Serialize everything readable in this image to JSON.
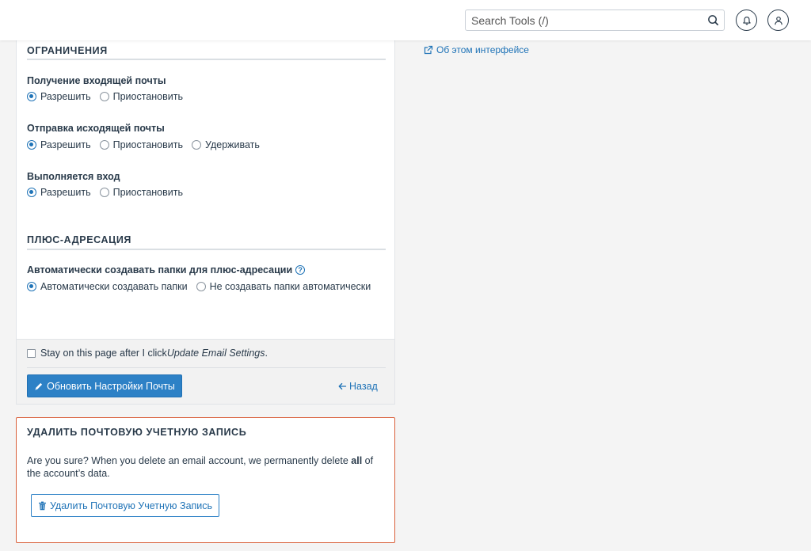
{
  "header": {
    "search_placeholder": "Search Tools (/)"
  },
  "restrictions": {
    "title": "ОГРАНИЧЕНИЯ",
    "incoming": {
      "label": "Получение входящей почты",
      "options": [
        "Разрешить",
        "Приостановить"
      ],
      "selected": "Разрешить"
    },
    "outgoing": {
      "label": "Отправка исходящей почты",
      "options": [
        "Разрешить",
        "Приостановить",
        "Удерживать"
      ],
      "selected": "Разрешить"
    },
    "login": {
      "label": "Выполняется вход",
      "options": [
        "Разрешить",
        "Приостановить"
      ],
      "selected": "Разрешить"
    }
  },
  "plus_addressing": {
    "title": "ПЛЮС-АДРЕСАЦИЯ",
    "auto": {
      "label": "Автоматически создавать папки для плюс-адресации",
      "help": "?",
      "options": [
        "Автоматически создавать папки",
        "Не создавать папки автоматически"
      ],
      "selected": "Автоматически создавать папки"
    }
  },
  "footer": {
    "stay_text": "Stay on this page after I click ",
    "stay_emph": "Update Email Settings",
    "stay_end": ".",
    "stay_checked": false,
    "update_button": "Обновить Настройки Почты",
    "back_link": "Назад"
  },
  "sidebar": {
    "about_link": "Об этом интерфейсе"
  },
  "delete": {
    "title": "УДАЛИТЬ ПОЧТОВУЮ УЧЕТНУЮ ЗАПИСЬ",
    "text_before": "Are you sure? When you delete an email account, we permanently delete ",
    "text_bold": "all",
    "text_after": " of the account’s data.",
    "button": "Удалить Почтовую Учетную Запись"
  },
  "colors": {
    "accent": "#1f73b7",
    "primary_button": "#2d81c6",
    "danger_border": "#d9603b"
  }
}
